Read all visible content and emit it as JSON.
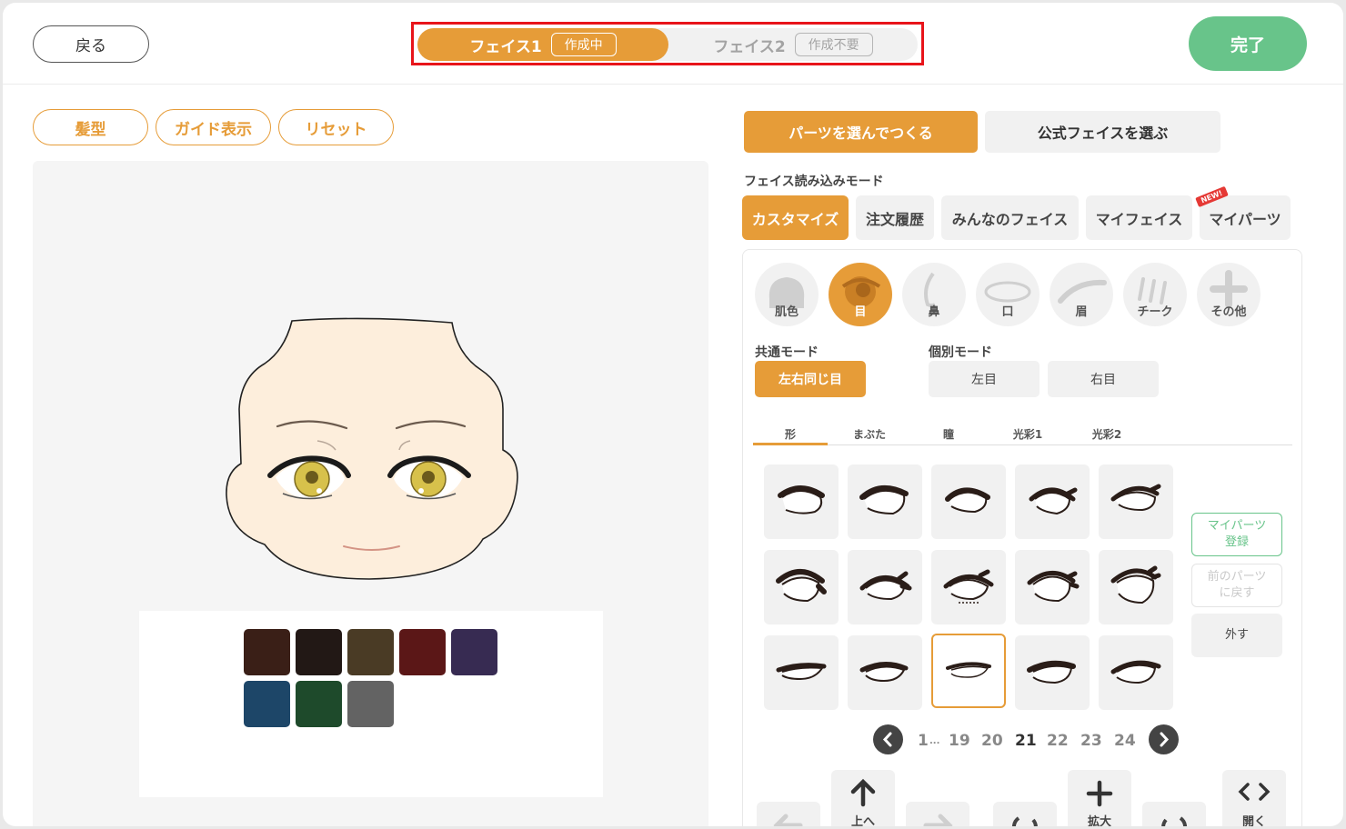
{
  "header": {
    "back_label": "戻る",
    "done_label": "完了",
    "faces": [
      {
        "name": "フェイス1",
        "status": "作成中"
      },
      {
        "name": "フェイス2",
        "status": "作成不要"
      }
    ]
  },
  "tools": {
    "hair_label": "髪型",
    "guide_label": "ガイド表示",
    "reset_label": "リセット"
  },
  "palette": {
    "colors": [
      "#3a1f17",
      "#221815",
      "#4a3b25",
      "#5b1717",
      "#372b52",
      "#1d4668",
      "#1e4a2b",
      "#636363"
    ]
  },
  "mode_tabs": {
    "build_label": "パーツを選んでつくる",
    "official_label": "公式フェイスを選ぶ"
  },
  "load_mode": {
    "title": "フェイス読み込みモード",
    "options": [
      "カスタマイズ",
      "注文履歴",
      "みんなのフェイス",
      "マイフェイス",
      "マイパーツ"
    ],
    "new_badge": "NEW!"
  },
  "categories": [
    "肌色",
    "目",
    "鼻",
    "口",
    "眉",
    "チーク",
    "その他"
  ],
  "eye_mode": {
    "common_title": "共通モード",
    "common_option": "左右同じ目",
    "individual_title": "個別モード",
    "left_label": "左目",
    "right_label": "右目"
  },
  "part_tabs": [
    "形",
    "まぶた",
    "瞳",
    "光彩1",
    "光彩2"
  ],
  "side_actions": {
    "register_line1": "マイパーツ",
    "register_line2": "登録",
    "revert_line1": "前のパーツ",
    "revert_line2": "に戻す",
    "remove_label": "外す"
  },
  "pager": {
    "first": "1",
    "ellipsis": "...",
    "pages": [
      "19",
      "20",
      "21",
      "22",
      "23",
      "24"
    ],
    "current": "21"
  },
  "controls": {
    "up_label": "上へ",
    "zoom_label": "拡大",
    "open_label": "開く"
  }
}
